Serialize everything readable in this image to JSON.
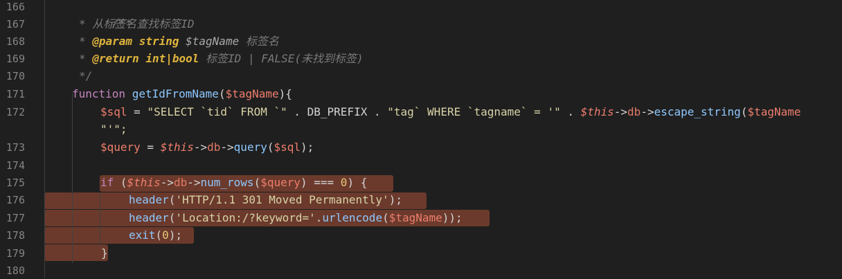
{
  "line_numbers": [
    "166",
    "167",
    "168",
    "169",
    "170",
    "171",
    "172",
    "173",
    "174",
    "175",
    "176",
    "177",
    "178",
    "179",
    "180"
  ],
  "code": {
    "l166": "/**",
    "l167_star": "* ",
    "l167_text": "从标签名查找标签ID",
    "l168_star": "* ",
    "l168_tag": "@param",
    "l168_type": "string",
    "l168_var": "$tagName",
    "l168_desc": "标签名",
    "l169_star": "* ",
    "l169_tag": "@return",
    "l169_type": "int|bool",
    "l169_desc": "标签ID | FALSE(未找到标签)",
    "l170": "*/",
    "l171_kw": "function",
    "l171_fn": "getIdFromName",
    "l171_p1": "(",
    "l171_var": "$tagName",
    "l171_p2": "){",
    "l172_var": "$sql",
    "l172_eq": " = ",
    "l172_s1": "\"SELECT `tid` FROM `\"",
    "l172_o1": " . ",
    "l172_c": "DB_PREFIX",
    "l172_o2": " . ",
    "l172_s2": "\"tag` WHERE `tagname` = '\"",
    "l172_o3": " . ",
    "l172_this": "$this",
    "l172_arr1": "->",
    "l172_db": "db",
    "l172_arr2": "->",
    "l172_fn": "escape_string",
    "l172_p": "(",
    "l172_var2": "$tagName",
    "l172b": "\"'\";",
    "l173_var": "$query",
    "l173_eq": " = ",
    "l173_this": "$this",
    "l173_arr1": "->",
    "l173_db": "db",
    "l173_arr2": "->",
    "l173_fn": "query",
    "l173_p1": "(",
    "l173_var2": "$sql",
    "l173_p2": ");",
    "l175_kw": "if",
    "l175_p1": " (",
    "l175_this": "$this",
    "l175_arr1": "->",
    "l175_db": "db",
    "l175_arr2": "->",
    "l175_fn": "num_rows",
    "l175_p2": "(",
    "l175_var": "$query",
    "l175_op": ") === ",
    "l175_num": "0",
    "l175_p3": ") {",
    "l176_fn": "header",
    "l176_p1": "(",
    "l176_str": "'HTTP/1.1 301 Moved Permanently'",
    "l176_p2": ");",
    "l177_fn": "header",
    "l177_p1": "(",
    "l177_str": "'Location:/?keyword='",
    "l177_dot": ".",
    "l177_fn2": "urlencode",
    "l177_p2": "(",
    "l177_var": "$tagName",
    "l177_p3": "));",
    "l178_fn": "exit",
    "l178_p1": "(",
    "l178_num": "0",
    "l178_p2": ");",
    "l179": "}"
  },
  "colors": {
    "background": "#1f1f1f",
    "selection": "#6b3a2c",
    "comment": "#7a7a7a",
    "doc_tag": "#e0b53d",
    "keyword": "#c586c0",
    "function": "#8ec8ff",
    "variable": "#ef7e6d",
    "string": "#d9d3a6"
  }
}
